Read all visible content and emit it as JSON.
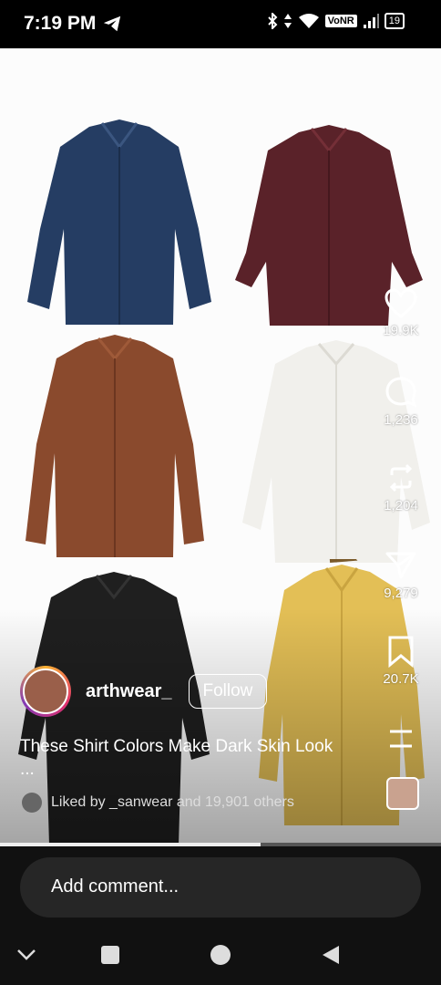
{
  "status_bar": {
    "time": "7:19 PM",
    "network": "VoNR",
    "battery": "19"
  },
  "post": {
    "username": "arthwear_",
    "follow_label": "Follow",
    "caption": "These Shirt Colors Make Dark Skin Look ...",
    "liked_by_text": "Liked by _sanwear and 19,901 others",
    "video_progress": 0.59
  },
  "actions": {
    "like_count": "19.9K",
    "comment_count": "1,236",
    "repost_count": "1,204",
    "share_count": "9,279",
    "save_count": "20.7K"
  },
  "shirts": [
    "navy",
    "maroon",
    "brown",
    "white",
    "black",
    "mustard"
  ],
  "comment_placeholder": "Add comment..."
}
